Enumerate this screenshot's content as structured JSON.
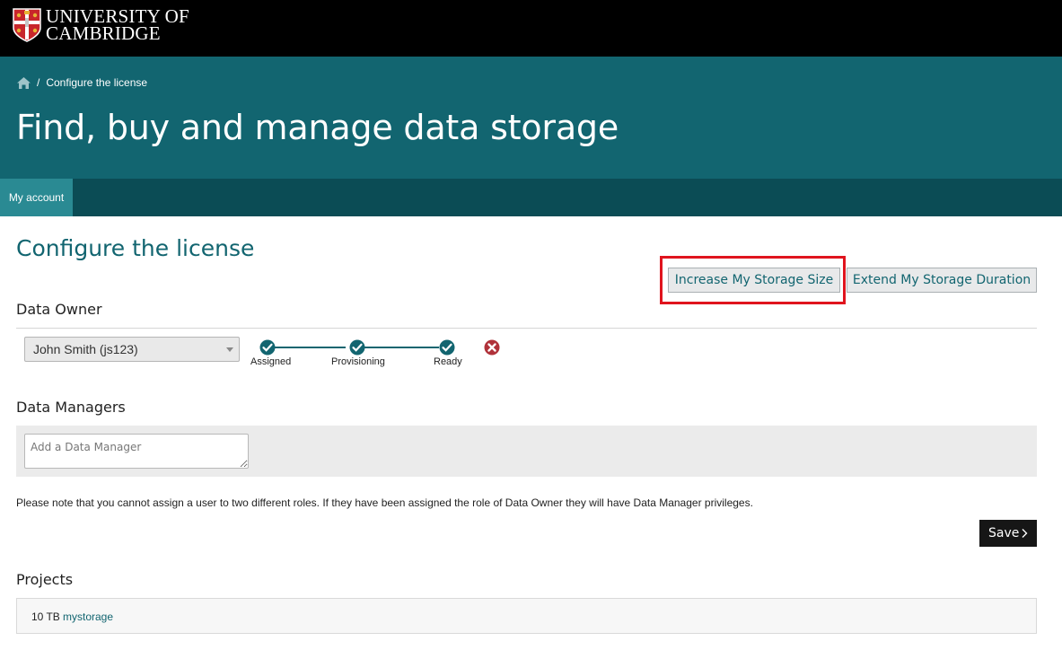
{
  "header": {
    "logo": {
      "line1": "UNIVERSITY OF",
      "line2": "CAMBRIDGE",
      "icon": "crest-icon"
    },
    "breadcrumb": {
      "home_icon": "home-icon",
      "separator": "/",
      "current": "Configure the license"
    },
    "page_title": "Find, buy and manage data storage",
    "nav": {
      "tabs": [
        {
          "label": "My account",
          "active": true
        }
      ]
    }
  },
  "main": {
    "title": "Configure the license",
    "actions": {
      "increase_label": "Increase My Storage Size",
      "extend_label": "Extend My Storage Duration"
    },
    "data_owner": {
      "heading": "Data Owner",
      "selected": "John Smith (js123)",
      "steps": [
        {
          "label": "Assigned",
          "status": "done"
        },
        {
          "label": "Provisioning",
          "status": "done"
        },
        {
          "label": "Ready",
          "status": "done"
        }
      ],
      "remove_icon": "close-circle-icon"
    },
    "data_managers": {
      "heading": "Data Managers",
      "placeholder": "Add a Data Manager"
    },
    "note": "Please note that you cannot assign a user to two different roles. If they have been assigned the role of Data Owner they will have Data Manager privileges.",
    "save_label": "Save",
    "projects": {
      "heading": "Projects",
      "items": [
        {
          "size": "10 TB",
          "name": "mystorage"
        }
      ]
    }
  },
  "colors": {
    "brand_teal": "#126570",
    "nav_dark": "#0b4c55",
    "nav_active": "#2a8a93",
    "highlight": "#e0141e",
    "danger": "#b0323a"
  }
}
